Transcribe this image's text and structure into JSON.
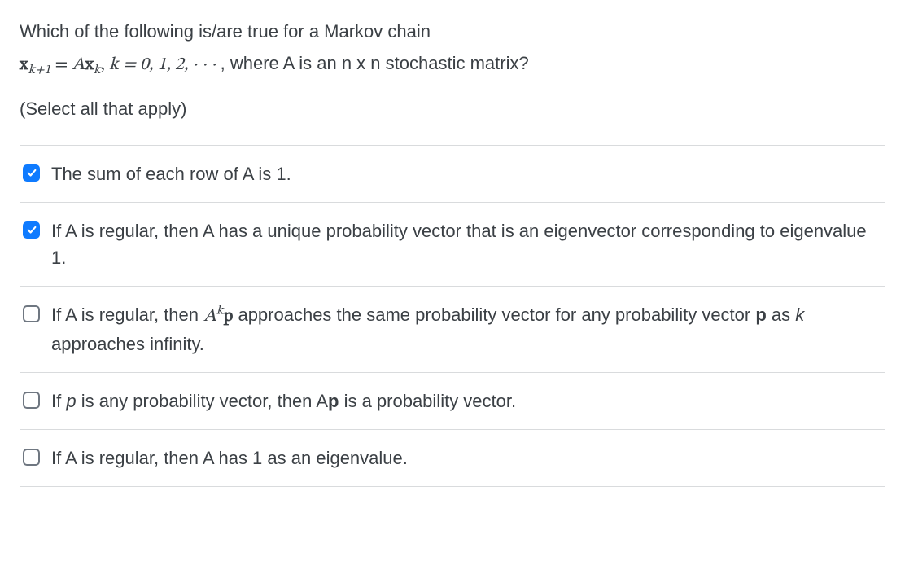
{
  "question": {
    "line1": "Which of the following is/are true for a Markov chain",
    "line2_tail": ", where A is an n x n stochastic matrix?",
    "instruction": "(Select all that apply)"
  },
  "math": {
    "xk1": "x",
    "sub_k1": "k+1",
    "eq1": " = ",
    "A": "A",
    "xk": "x",
    "sub_k": "k",
    "comma_sep": ",  ",
    "k_eq": "k = 0, 1, 2, · · ·"
  },
  "options": [
    {
      "checked": true,
      "plain": "The sum of each row of A is 1."
    },
    {
      "checked": true,
      "plain": "If A is regular, then A has a unique probability vector that is an eigenvector corresponding to eigenvalue 1."
    },
    {
      "checked": false,
      "pre": "If A is regular, then ",
      "math_A": "A",
      "math_sup": "k",
      "math_p": "p",
      "mid": " approaches the same probability vector for any probability vector ",
      "bold_p": "p",
      "post1": " as ",
      "ital_k": "k",
      "post2": " approaches infinity."
    },
    {
      "checked": false,
      "pre": "If ",
      "ital_p": "p",
      "mid": " is any probability vector, then A",
      "bold_p": "p",
      "post": " is a probability vector."
    },
    {
      "checked": false,
      "plain": "If A is regular, then A has 1 as an eigenvalue."
    }
  ]
}
